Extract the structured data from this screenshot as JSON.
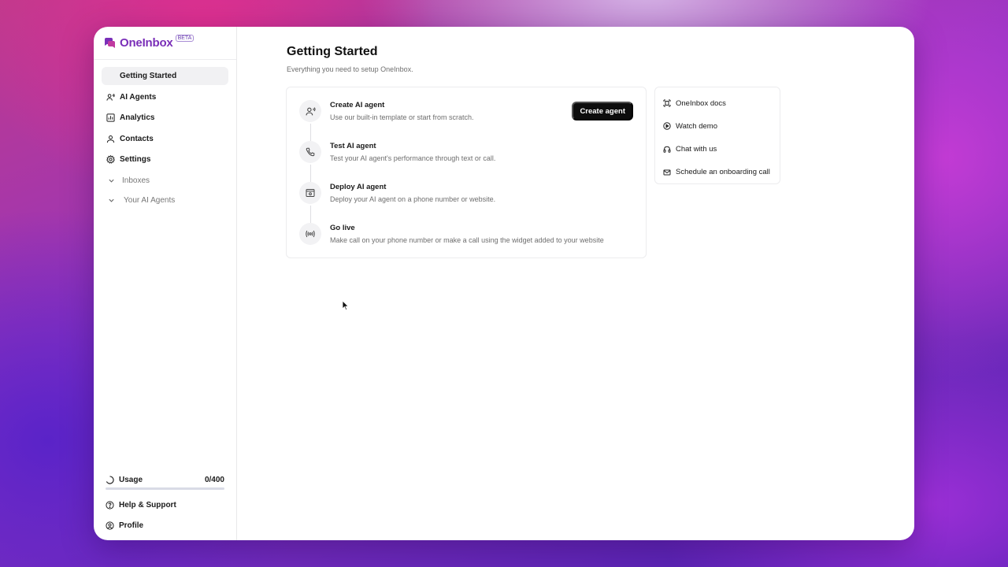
{
  "brand": {
    "name": "OneInbox",
    "badge": "BETA"
  },
  "sidebar": {
    "items": [
      {
        "label": "Getting Started",
        "icon": "none",
        "active": true
      },
      {
        "label": "AI Agents",
        "icon": "user-voice-icon"
      },
      {
        "label": "Analytics",
        "icon": "chart-icon"
      },
      {
        "label": "Contacts",
        "icon": "person-icon"
      },
      {
        "label": "Settings",
        "icon": "gear-icon"
      }
    ],
    "sections": [
      {
        "label": "Inboxes",
        "icon": "chevron-down-icon"
      },
      {
        "label": "Your AI Agents",
        "icon": "chevron-down-icon"
      }
    ],
    "usage": {
      "label": "Usage",
      "count": "0/400",
      "fraction": 0
    },
    "help_label": "Help & Support",
    "profile_label": "Profile"
  },
  "page": {
    "title": "Getting Started",
    "subtitle": "Everything you need to setup OneInbox."
  },
  "steps": [
    {
      "title": "Create AI agent",
      "desc": "Use our built-in template or start from scratch.",
      "icon": "user-voice-icon"
    },
    {
      "title": "Test AI agent",
      "desc": "Test your AI agent's performance through text or call.",
      "icon": "phone-icon"
    },
    {
      "title": "Deploy AI agent",
      "desc": "Deploy your AI agent on a phone number or website.",
      "icon": "browser-icon"
    },
    {
      "title": "Go live",
      "desc": "Make call on your phone number or make a call using the widget added to your website",
      "icon": "broadcast-icon"
    }
  ],
  "create_button_label": "Create agent",
  "resources": [
    {
      "label": "OneInbox docs",
      "icon": "docs-icon"
    },
    {
      "label": "Watch demo",
      "icon": "play-icon"
    },
    {
      "label": "Chat with us",
      "icon": "headset-icon"
    },
    {
      "label": "Schedule an onboarding call",
      "icon": "mail-icon"
    }
  ],
  "colors": {
    "brand": "#7a2fb8",
    "button": "#0d0d0d",
    "usage_bar": "#d9dbe6"
  }
}
